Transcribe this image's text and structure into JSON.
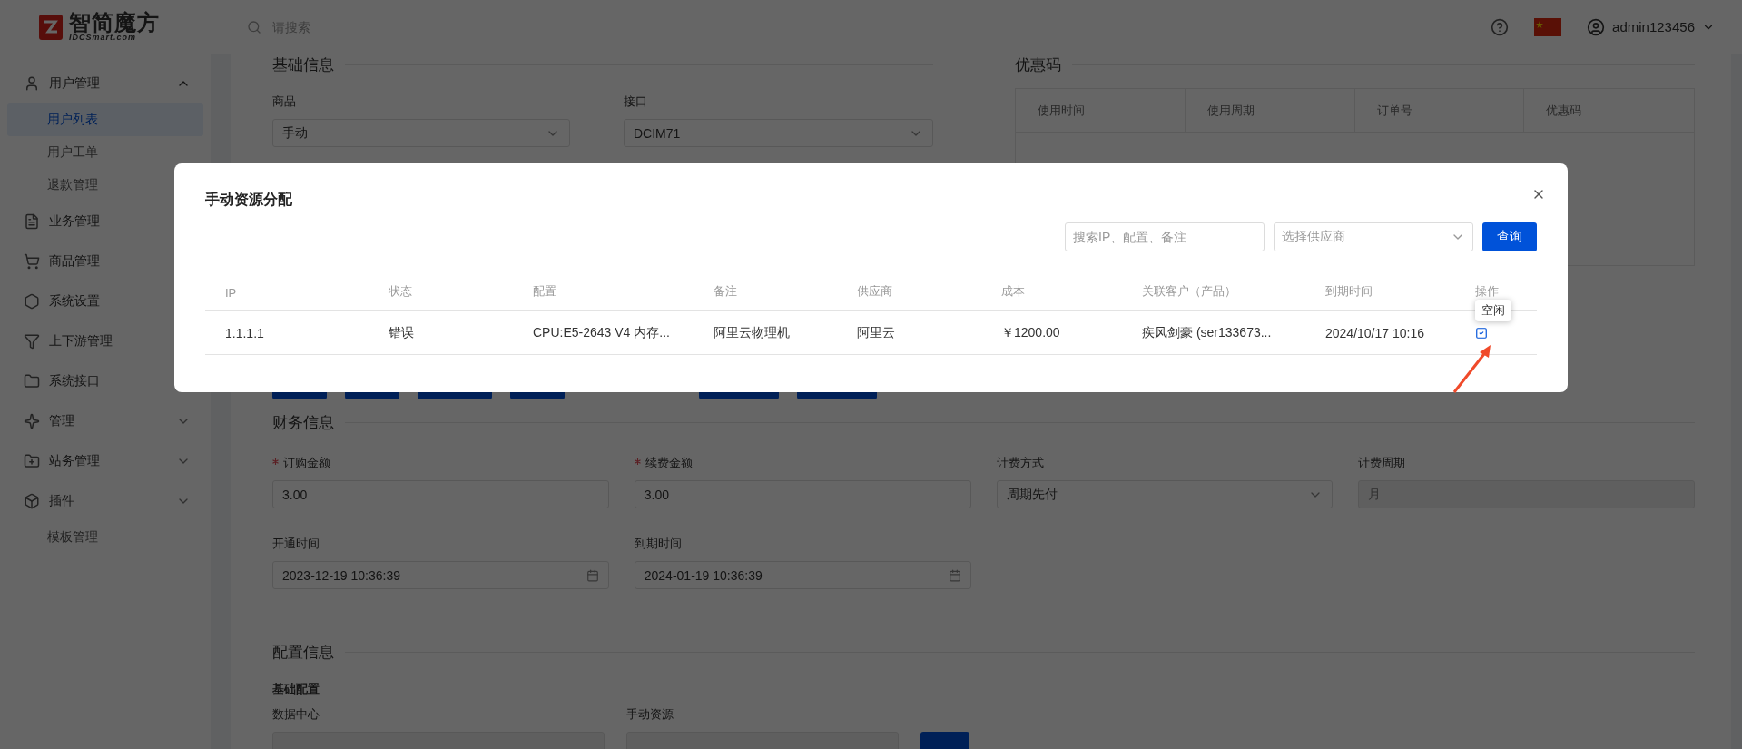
{
  "header": {
    "logo_text": "智简魔方",
    "logo_sub": "IDCSmart.com",
    "search": {
      "placeholder": "请搜索"
    },
    "user": "admin123456"
  },
  "sidebar": {
    "items": [
      {
        "label": "用户管理",
        "kind": "group",
        "expanded": true,
        "children": [
          {
            "label": "用户列表",
            "selected": true
          },
          {
            "label": "用户工单",
            "selected": false
          },
          {
            "label": "退款管理",
            "selected": false
          }
        ]
      },
      {
        "label": "业务管理",
        "kind": "link"
      },
      {
        "label": "商品管理",
        "kind": "link"
      },
      {
        "label": "系统设置",
        "kind": "link"
      },
      {
        "label": "上下游管理",
        "kind": "link"
      },
      {
        "label": "系统接口",
        "kind": "link"
      },
      {
        "label": "管理",
        "kind": "group",
        "expanded": false
      },
      {
        "label": "站务管理",
        "kind": "group",
        "expanded": false
      },
      {
        "label": "插件",
        "kind": "group",
        "expanded": false
      },
      {
        "label": "模板管理",
        "kind": "plain"
      }
    ]
  },
  "basic": {
    "title": "基础信息",
    "fields": [
      {
        "label": "商品",
        "value": "手动",
        "kind": "select"
      },
      {
        "label": "接口",
        "value": "DCIM71",
        "kind": "select"
      }
    ]
  },
  "coupon": {
    "title": "优惠码",
    "columns": [
      "使用时间",
      "使用周期",
      "订单号",
      "优惠码"
    ]
  },
  "finance": {
    "title": "财务信息",
    "fields": [
      {
        "label": "订购金额",
        "required": true,
        "value": "3.00",
        "kind": "input"
      },
      {
        "label": "续费金额",
        "required": true,
        "value": "3.00",
        "kind": "input"
      },
      {
        "label": "计费方式",
        "required": false,
        "value": "周期先付",
        "kind": "select"
      },
      {
        "label": "计费周期",
        "required": false,
        "value": "月",
        "kind": "disabled"
      },
      {
        "label": "开通时间",
        "required": false,
        "value": "2023-12-19 10:36:39",
        "kind": "date"
      },
      {
        "label": "到期时间",
        "required": false,
        "value": "2024-01-19 10:36:39",
        "kind": "date"
      }
    ]
  },
  "config": {
    "title": "配置信息",
    "subtitle": "基础配置",
    "fields": [
      {
        "label": "数据中心"
      },
      {
        "label": "手动资源"
      }
    ]
  },
  "dialog": {
    "title": "手动资源分配",
    "search": {
      "placeholder": "搜索IP、配置、备注"
    },
    "supplier": {
      "placeholder": "选择供应商"
    },
    "query_button": "查询",
    "columns": [
      "IP",
      "状态",
      "配置",
      "备注",
      "供应商",
      "成本",
      "关联客户（产品）",
      "到期时间",
      "操作"
    ],
    "rows": [
      {
        "cells": [
          "1.1.1.1",
          "错误",
          "CPU:E5-2643 V4 内存...",
          "阿里云物理机",
          "阿里云",
          "￥1200.00",
          "疾风剑豪 (ser133673...",
          "2024/10/17 10:16"
        ]
      }
    ],
    "tooltip": "空闲"
  }
}
